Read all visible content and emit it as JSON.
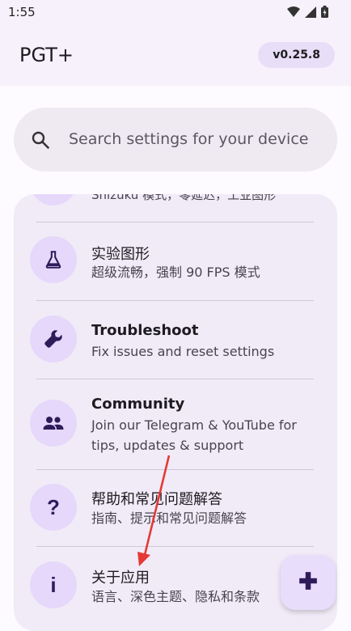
{
  "status_bar": {
    "time": "1:55"
  },
  "app_bar": {
    "title": "PGT+",
    "version": "v0.25.8"
  },
  "search": {
    "placeholder": "Search settings for your device"
  },
  "list": {
    "partial_subtitle": "Shizuku 模式，零延迟，工业图形",
    "items": [
      {
        "title": "实验图形",
        "subtitle": "超级流畅，强制 90 FPS 模式",
        "icon": "flask-icon"
      },
      {
        "title": "Troubleshoot",
        "subtitle": "Fix issues and reset settings",
        "icon": "wrench-icon"
      },
      {
        "title": "Community",
        "subtitle": "Join our Telegram & YouTube for tips, updates & support",
        "icon": "people-icon"
      },
      {
        "title": "帮助和常见问题解答",
        "subtitle": "指南、提示和常见问题解答",
        "icon": "question-icon"
      },
      {
        "title": "关于应用",
        "subtitle": "语言、深色主题、隐私和条款",
        "icon": "info-icon"
      }
    ]
  },
  "fab": {
    "icon": "gamepad-icon"
  },
  "colors": {
    "accent": "#e8def8",
    "icon_fill": "#2d1b5a",
    "arrow": "#e53935"
  }
}
